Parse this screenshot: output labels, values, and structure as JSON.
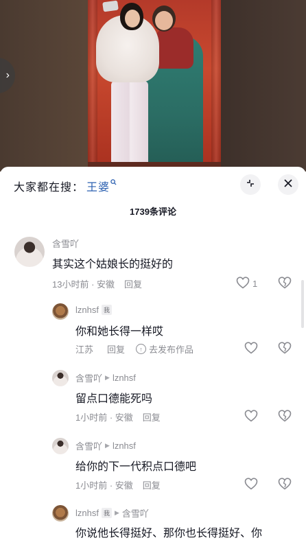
{
  "video": {
    "side_button_glyph": "›"
  },
  "sheet": {
    "search_prefix": "大家都在搜：",
    "search_term": "王婆",
    "comment_count": "1739条评论",
    "icons": {
      "collapse": "collapse-icon",
      "close": "close-icon"
    }
  },
  "comments": [
    {
      "user": "含雪吖",
      "text": "其实这个姑娘长的挺好的",
      "time_location": "13小时前 · 安徽",
      "reply_label": "回复",
      "like_count": "1"
    },
    {
      "user": "lznhsf",
      "author_tag": "我",
      "text": "你和她长得一样哎",
      "location": "江苏",
      "reply_label": "回复",
      "post_label": "去发布作品"
    },
    {
      "user": "含雪吖",
      "reply_to": "lznhsf",
      "text": "留点口德能死吗",
      "time_location": "1小时前 · 安徽",
      "reply_label": "回复"
    },
    {
      "user": "含雪吖",
      "reply_to": "lznhsf",
      "text": "给你的下一代积点口德吧",
      "time_location": "1小时前 · 安徽",
      "reply_label": "回复"
    },
    {
      "user": "lznhsf",
      "author_tag": "我",
      "reply_to": "含雪吖",
      "text": "你说他长得挺好、那你也长得挺好、你"
    }
  ],
  "colors": {
    "link_blue": "#2a5fb0",
    "muted_text": "#8a8b91",
    "primary_text": "#161823"
  }
}
